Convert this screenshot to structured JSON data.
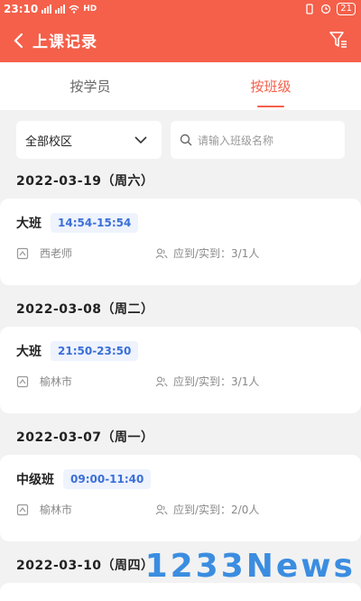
{
  "status_bar": {
    "time": "23:10",
    "left_icons": [
      "signal-icon",
      "signal-icon",
      "wifi-icon",
      "hd-icon"
    ],
    "battery": "21"
  },
  "header": {
    "title": "上课记录",
    "back_icon": "chevron-left-icon",
    "filter_icon": "filter-icon"
  },
  "tabs": [
    {
      "label": "按学员",
      "active": false
    },
    {
      "label": "按班级",
      "active": true
    }
  ],
  "filters": {
    "campus": "全部校区",
    "search_placeholder": "请输入班级名称"
  },
  "records": [
    {
      "date": "2022-03-19（周六）",
      "class": "大班",
      "time": "14:54-15:54",
      "teacher": "西老师",
      "attendance": "应到/实到：3/1人"
    },
    {
      "date": "2022-03-08（周二）",
      "class": "大班",
      "time": "21:50-23:50",
      "teacher": "榆林市",
      "attendance": "应到/实到：3/1人"
    },
    {
      "date": "2022-03-07（周一）",
      "class": "中级班",
      "time": "09:00-11:40",
      "teacher": "榆林市",
      "attendance": "应到/实到：2/0人"
    },
    {
      "date": "2022-03-10（周四）"
    }
  ],
  "watermark": "1233News",
  "colors": {
    "accent": "#f4604a",
    "time_tag_text": "#3b6fd8",
    "time_tag_bg": "#eef3fd"
  }
}
